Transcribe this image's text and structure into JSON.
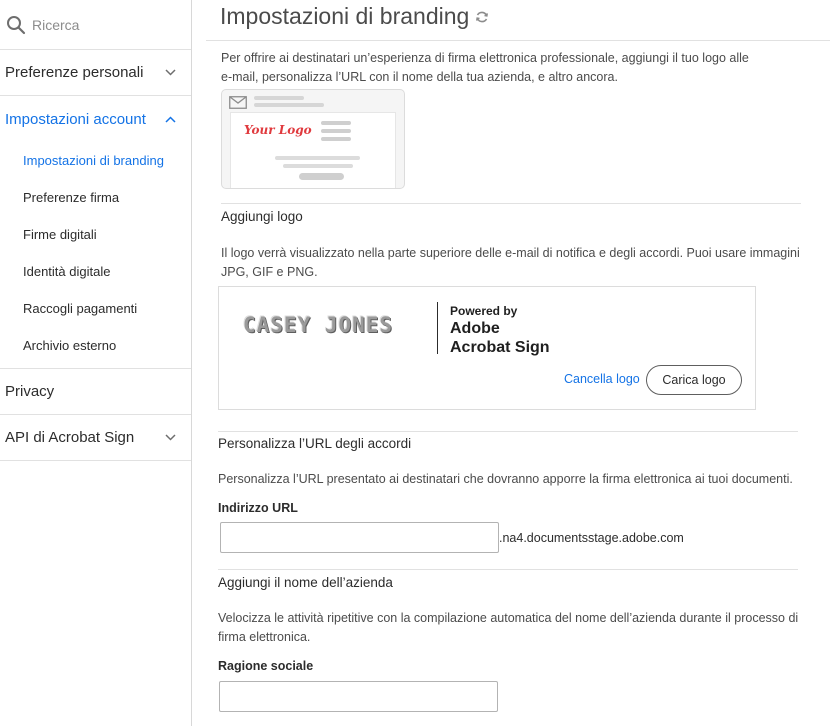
{
  "sidebar": {
    "search_placeholder": "Ricerca",
    "items": [
      {
        "label": "Preferenze personali"
      },
      {
        "label": "Impostazioni account"
      },
      {
        "label": "Privacy"
      },
      {
        "label": "API di Acrobat Sign"
      }
    ],
    "subitems": [
      {
        "label": "Impostazioni di branding"
      },
      {
        "label": "Preferenze firma"
      },
      {
        "label": "Firme digitali"
      },
      {
        "label": "Identità digitale"
      },
      {
        "label": "Raccogli pagamenti"
      },
      {
        "label": "Archivio esterno"
      }
    ]
  },
  "main": {
    "title": "Impostazioni di branding",
    "intro": "Per offrire ai destinatari un’esperienza di firma elettronica professionale, aggiungi il tuo logo alle e-mail, personalizza l’URL con il nome della tua azienda, e altro ancora.",
    "preview_logo_text": "Your Logo",
    "logo_section": {
      "title": "Aggiungi logo",
      "description": "Il logo verrà visualizzato nella parte superiore delle e-mail di notifica e degli accordi. Puoi usare immagini JPG, GIF e PNG.",
      "current_logo_text": "CASEY JONES",
      "powered_by": "Powered by",
      "brand_line1": "Adobe",
      "brand_line2": "Acrobat Sign",
      "delete_label": "Cancella logo",
      "upload_label": "Carica logo"
    },
    "url_section": {
      "title": "Personalizza l’URL degli accordi",
      "description": "Personalizza l’URL presentato ai destinatari che dovranno apporre la firma elettronica ai tuoi documenti.",
      "field_label": "Indirizzo URL",
      "field_value": "",
      "suffix": ".na4.documentsstage.adobe.com"
    },
    "company_section": {
      "title": "Aggiungi il nome dell’azienda",
      "description": "Velocizza le attività ripetitive con la compilazione automatica del nome dell’azienda durante il processo di firma elettronica.",
      "field_label": "Ragione sociale",
      "field_value": ""
    }
  },
  "colors": {
    "accent": "#1473e6",
    "text": "#2c2c2c",
    "divider": "#e1e1e1"
  },
  "icons": [
    "search-icon",
    "chevron-down-icon",
    "chevron-up-icon",
    "refresh-icon",
    "envelope-icon"
  ]
}
